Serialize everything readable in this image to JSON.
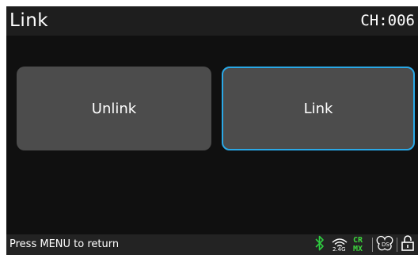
{
  "header": {
    "title": "Link",
    "channel": "CH:006"
  },
  "buttons": {
    "unlink_label": "Unlink",
    "link_label": "Link"
  },
  "footer": {
    "hint": "Press MENU to return"
  },
  "status_icons": {
    "bluetooth": {
      "icon": "bluetooth-icon",
      "color": "#2ecc40"
    },
    "wireless": {
      "icon": "wireless-icon",
      "label": "2.4G"
    },
    "crmx": {
      "icon": "crmx-icon",
      "top": "CR",
      "bottom": "MX",
      "color": "#3dd63d"
    },
    "ds": {
      "icon": "ds-icon"
    },
    "lock": {
      "icon": "unlock-icon"
    }
  },
  "colors": {
    "screen_bg": "#101010",
    "header_bg": "#1e1e1e",
    "button_bg": "#4c4c4c",
    "selected_border": "#2aa8e6"
  }
}
